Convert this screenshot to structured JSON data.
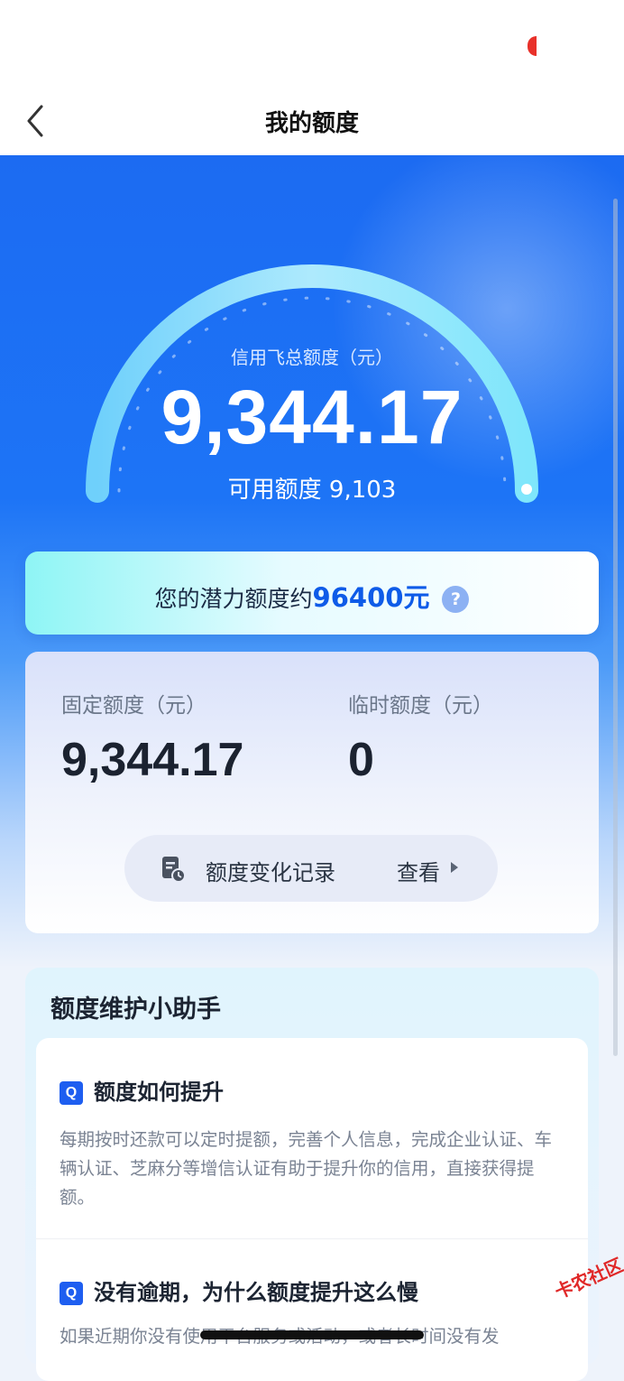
{
  "status_bar": {},
  "nav": {
    "title": "我的额度"
  },
  "gauge": {
    "label": "信用飞总额度（元）",
    "total": "9,344.17",
    "available": "可用额度 9,103"
  },
  "potential": {
    "prefix": "您的潜力额度约",
    "amount": "96400元",
    "help_glyph": "?"
  },
  "quota": {
    "fixed_label": "固定额度（元）",
    "fixed_value": "9,344.17",
    "temp_label": "临时额度（元）",
    "temp_value": "0",
    "history_label": "额度变化记录",
    "view_label": "查看"
  },
  "helper": {
    "title": "额度维护小助手",
    "items": [
      {
        "badge": "Q",
        "question": "额度如何提升",
        "answer": "每期按时还款可以定时提额，完善个人信息，完成企业认证、车辆认证、芝麻分等增信认证有助于提升你的信用，直接获得提额。"
      },
      {
        "badge": "Q",
        "question": "没有逾期，为什么额度提升这么慢",
        "answer": "如果近期你没有使用平台服务或活动，或者长时间没有发"
      }
    ]
  },
  "watermark": {
    "text": "卡农社区"
  },
  "colors": {
    "accent": "#1e5ef0",
    "hero_top": "#1c6bf2",
    "potential_amount": "#0e5be8"
  }
}
